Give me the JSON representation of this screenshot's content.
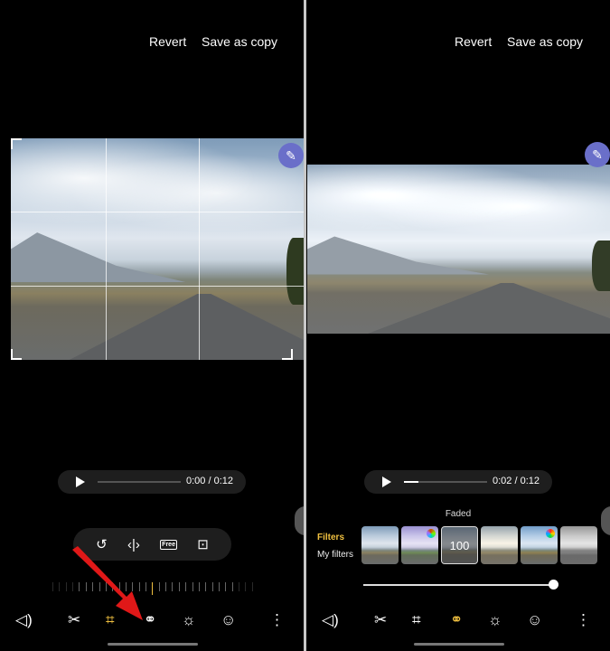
{
  "header": {
    "revert_label": "Revert",
    "save_copy_label": "Save as copy"
  },
  "left": {
    "player": {
      "time": "0:00 / 0:12",
      "progress": 0
    },
    "crop_tools": {
      "rotate": "↺",
      "flip": "‹|›",
      "free": "Free",
      "aspect": "⊡"
    },
    "active_tool": "crop"
  },
  "right": {
    "player": {
      "time": "0:02 / 0:12",
      "progress": 0.17
    },
    "filter_name": "Faded",
    "tabs": {
      "filters": "Filters",
      "my_filters": "My filters"
    },
    "selected_filter_value": "100",
    "intensity": 1.0,
    "active_tool": "filters"
  },
  "toolbar": {
    "icons": [
      "volume-icon",
      "scissors-icon",
      "crop-rotate-icon",
      "filters-icon",
      "brightness-icon",
      "sticker-icon",
      "more-icon"
    ],
    "glyphs": [
      "◁)",
      "✂",
      "⌗",
      "⚭",
      "☼",
      "☺",
      "⋮"
    ]
  },
  "colors": {
    "accent": "#f0c040",
    "annotation_arrow": "#e01818",
    "pen_button": "#6a6fc9"
  }
}
